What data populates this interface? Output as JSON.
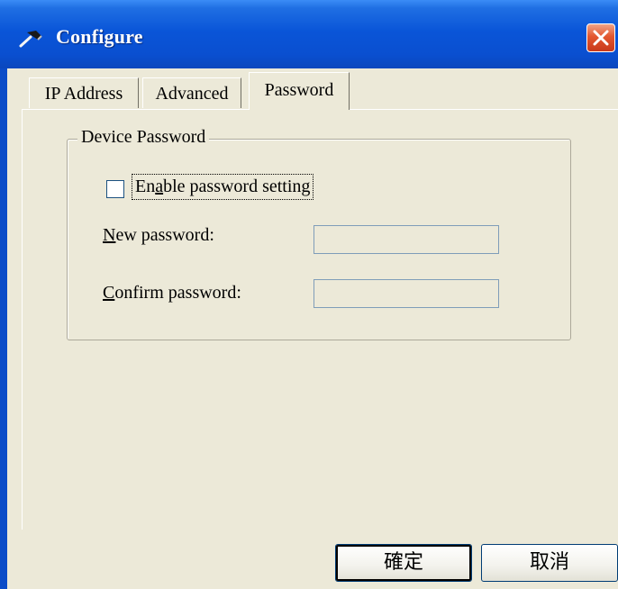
{
  "window": {
    "title": "Configure",
    "icon": "hammer-icon",
    "close_icon": "close-icon"
  },
  "tabs": [
    {
      "label": "IP Address",
      "active": false
    },
    {
      "label": "Advanced",
      "active": false
    },
    {
      "label": "Password",
      "active": true
    }
  ],
  "group": {
    "label": "Device Password",
    "enable_checkbox": {
      "label_pre": "En",
      "label_mnemonic": "a",
      "label_post": "ble password setting",
      "checked": false
    },
    "new_password": {
      "label_mnemonic": "N",
      "label_rest": "ew password:",
      "value": ""
    },
    "confirm_password": {
      "label_mnemonic": "C",
      "label_rest": "onfirm password:",
      "value": ""
    }
  },
  "buttons": {
    "ok": "確定",
    "cancel": "取消"
  },
  "colors": {
    "titlebar": "#0a55d8",
    "dialog_bg": "#ece9d8",
    "close": "#e3572f"
  }
}
